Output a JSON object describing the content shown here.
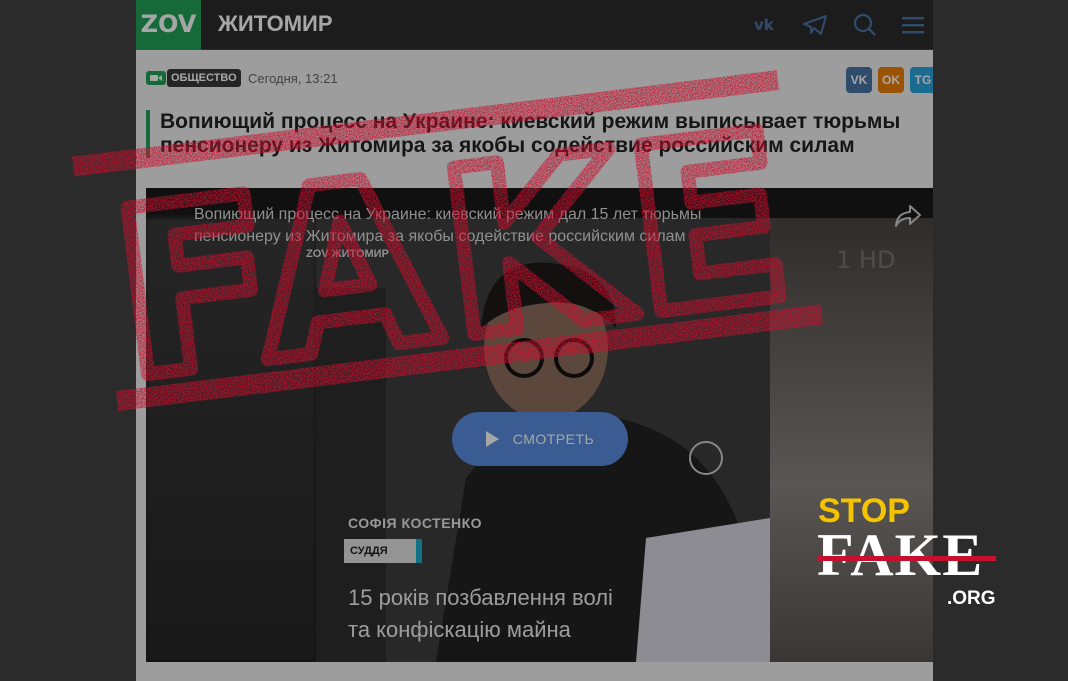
{
  "site": {
    "logo": "ZOV",
    "city": "ЖИТОМИР",
    "icons": [
      "vk-icon",
      "telegram-icon",
      "search-icon",
      "menu-icon"
    ]
  },
  "article": {
    "rubric": "ОБЩЕСТВО",
    "date": "Сегодня, 13:21",
    "share_labels": {
      "vk": "VK",
      "ok": "OK",
      "tg": "TG"
    },
    "headline_line1": "Вопиющий процесс на Украине: киевский режим выписывает тюрьмы",
    "headline_line2": "пенсионеру из Житомира за якобы содействие российским силам"
  },
  "video": {
    "title_line1": "Вопиющий процесс на Украине: киевский режим дал 15 лет тюрьмы",
    "title_line2": "пенсионеру из Житомира за якобы содействие российским силам",
    "subtitle": "ZOV ЖИТОМИР",
    "hd_label": "1 HD",
    "play_label": "СМОТРЕТЬ",
    "person_name": "СОФІЯ КОСТЕНКО",
    "person_role": "СУДДЯ",
    "verdict_line1": "15 років позбавлення волі",
    "verdict_line2": "та конфіскацію майна"
  },
  "stamp": {
    "text": "FAKE",
    "color": "#c8102e"
  },
  "brand": {
    "stop": "STOP",
    "fake": "FAKE",
    "org": ".ORG",
    "stop_color": "#f5c400",
    "line_color": "#c8102e"
  },
  "colors": {
    "accent": "#23a35a",
    "play": "#5a8ee0",
    "vk": "#4a76a8",
    "ok": "#ee8208",
    "tg": "#2aa3df"
  }
}
